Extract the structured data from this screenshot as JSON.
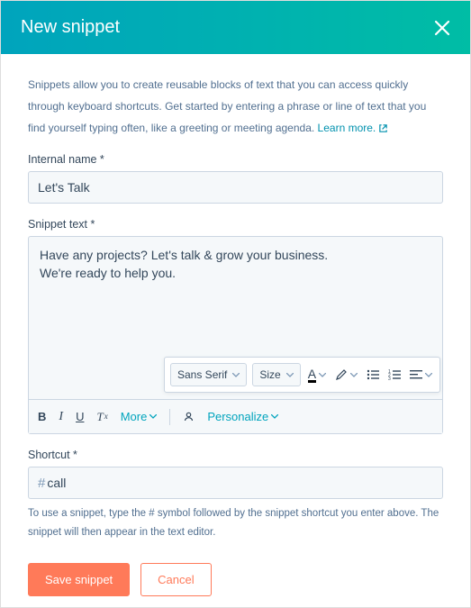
{
  "header": {
    "title": "New snippet"
  },
  "intro": {
    "text": "Snippets allow you to create reusable blocks of text that you can access quickly through keyboard shortcuts. Get started by entering a phrase or line of text that you find yourself typing often, like a greeting or meeting agenda.",
    "learn_more": "Learn more."
  },
  "form": {
    "internal_name_label": "Internal name *",
    "internal_name_value": "Let's Talk",
    "snippet_text_label": "Snippet text *",
    "snippet_text_value": "Have any projects? Let's talk & grow your business.\nWe're ready to help you.",
    "shortcut_label": "Shortcut *",
    "shortcut_prefix": "#",
    "shortcut_value": "call",
    "shortcut_hint": "To use a snippet, type the # symbol followed by the snippet shortcut you enter above. The snippet will then appear in the text editor."
  },
  "toolbar": {
    "bold": "B",
    "italic": "I",
    "underline": "U",
    "more": "More",
    "personalize": "Personalize"
  },
  "floating": {
    "font_family": "Sans Serif",
    "font_size": "Size",
    "font_color_letter": "A"
  },
  "footer": {
    "save": "Save snippet",
    "cancel": "Cancel"
  }
}
